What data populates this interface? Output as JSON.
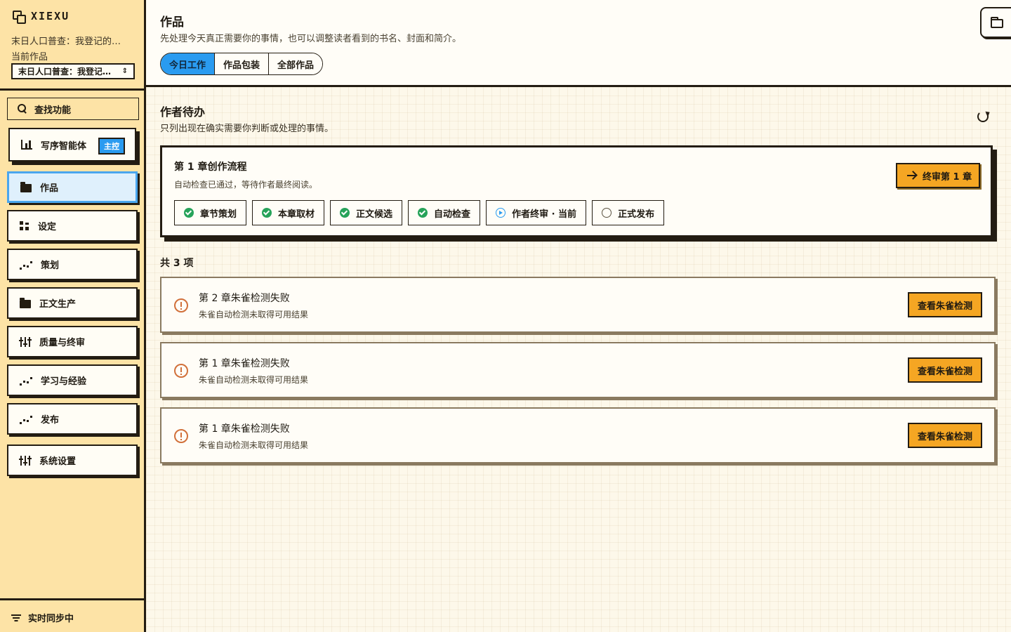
{
  "brand": {
    "name": "XIEXU"
  },
  "book": {
    "truncated_title": "末日人口普查：我登记的…",
    "current_label": "当前作品",
    "select_value": "末日人口普查：我登记…"
  },
  "search": {
    "label": "查找功能"
  },
  "nav": {
    "agent": {
      "label": "写序智能体",
      "badge": "主控"
    },
    "items": [
      {
        "label": "作品",
        "icon": "folder-icon",
        "active": true
      },
      {
        "label": "设定",
        "icon": "grid-icon"
      },
      {
        "label": "策划",
        "icon": "trend-icon"
      },
      {
        "label": "正文生产",
        "icon": "folder-icon"
      },
      {
        "label": "质量与终审",
        "icon": "sliders-icon"
      },
      {
        "label": "学习与经验",
        "icon": "trend-icon"
      },
      {
        "label": "发布",
        "icon": "trend-icon"
      },
      {
        "label": "系统设置",
        "icon": "sliders-icon"
      }
    ]
  },
  "sync": {
    "label": "实时同步中"
  },
  "header": {
    "title": "作品",
    "subtitle": "先处理今天真正需要你的事情，也可以调整读者看到的书名、封面和简介。",
    "tabs": [
      {
        "label": "今日工作",
        "active": true
      },
      {
        "label": "作品包装"
      },
      {
        "label": "全部作品"
      }
    ]
  },
  "todo": {
    "title": "作者待办",
    "subtitle": "只列出现在确实需要你判断或处理的事情。"
  },
  "flow": {
    "title": "第 1 章创作流程",
    "subtitle": "自动检查已通过，等待作者最终阅读。",
    "action": "终审第 1 章",
    "steps": [
      {
        "label": "章节策划",
        "status": "done"
      },
      {
        "label": "本章取材",
        "status": "done"
      },
      {
        "label": "正文候选",
        "status": "done"
      },
      {
        "label": "自动检查",
        "status": "done"
      },
      {
        "label": "作者终审 · 当前",
        "status": "current"
      },
      {
        "label": "正式发布",
        "status": "pending"
      }
    ]
  },
  "count": "共 3 项",
  "tasks": [
    {
      "title": "第 2 章朱雀检测失败",
      "subtitle": "朱雀自动检测未取得可用结果",
      "action": "查看朱雀检测"
    },
    {
      "title": "第 1 章朱雀检测失败",
      "subtitle": "朱雀自动检测未取得可用结果",
      "action": "查看朱雀检测"
    },
    {
      "title": "第 1 章朱雀检测失败",
      "subtitle": "朱雀自动检测未取得可用结果",
      "action": "查看朱雀检测"
    }
  ],
  "colors": {
    "sidebar_bg": "#fde3a6",
    "accent_blue": "#2a9bf0",
    "accent_orange": "#f5a623",
    "success_green": "#27a35a",
    "warning_orange": "#d1703a"
  }
}
